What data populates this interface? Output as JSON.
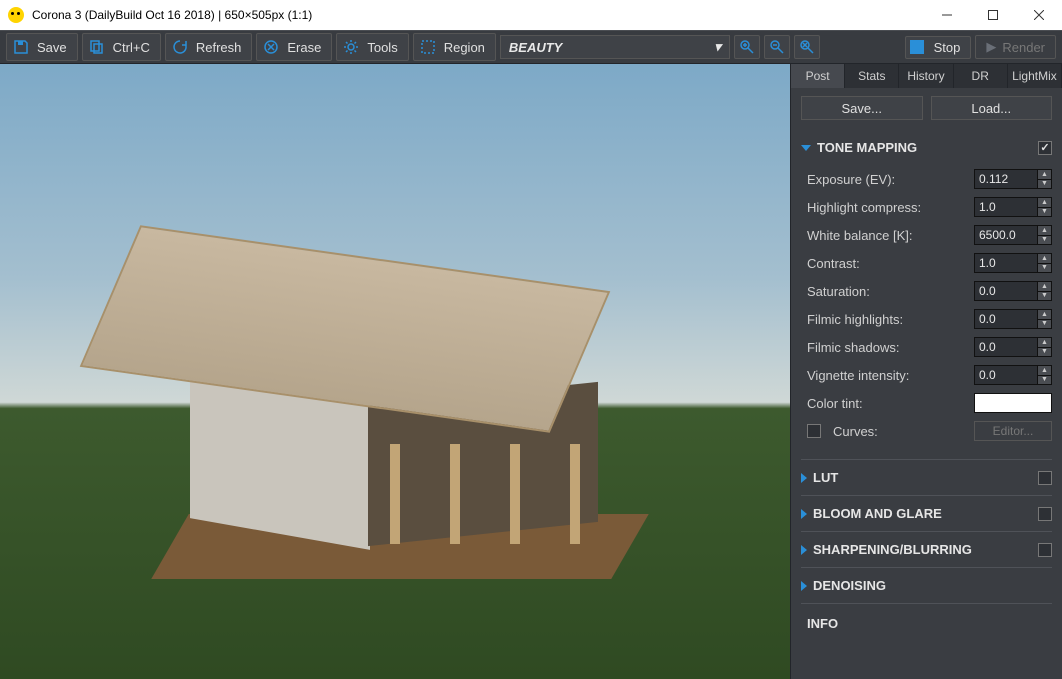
{
  "window": {
    "title": "Corona 3 (DailyBuild Oct 16 2018) | 650×505px (1:1)"
  },
  "toolbar": {
    "save": "Save",
    "ctrlc": "Ctrl+C",
    "refresh": "Refresh",
    "erase": "Erase",
    "tools": "Tools",
    "region": "Region",
    "pass": "BEAUTY",
    "stop": "Stop",
    "render": "Render"
  },
  "tabs": [
    "Post",
    "Stats",
    "History",
    "DR",
    "LightMix"
  ],
  "panel_buttons": {
    "save": "Save...",
    "load": "Load..."
  },
  "sections": {
    "tone_mapping": {
      "title": "TONE MAPPING",
      "enabled": true,
      "props": {
        "exposure_label": "Exposure (EV):",
        "exposure": "0.112",
        "hlcompress_label": "Highlight compress:",
        "hlcompress": "1.0",
        "wb_label": "White balance [K]:",
        "wb": "6500.0",
        "contrast_label": "Contrast:",
        "contrast": "1.0",
        "saturation_label": "Saturation:",
        "saturation": "0.0",
        "filmhi_label": "Filmic highlights:",
        "filmhi": "0.0",
        "filmsh_label": "Filmic shadows:",
        "filmsh": "0.0",
        "vignette_label": "Vignette intensity:",
        "vignette": "0.0",
        "tint_label": "Color tint:",
        "tint": "#ffffff",
        "curves_label": "Curves:",
        "editor": "Editor..."
      }
    },
    "lut": {
      "title": "LUT",
      "enabled": false
    },
    "bloom": {
      "title": "BLOOM AND GLARE",
      "enabled": false
    },
    "sharpen": {
      "title": "SHARPENING/BLURRING",
      "enabled": false
    },
    "denoise": {
      "title": "DENOISING"
    },
    "info": {
      "title": "INFO"
    }
  }
}
